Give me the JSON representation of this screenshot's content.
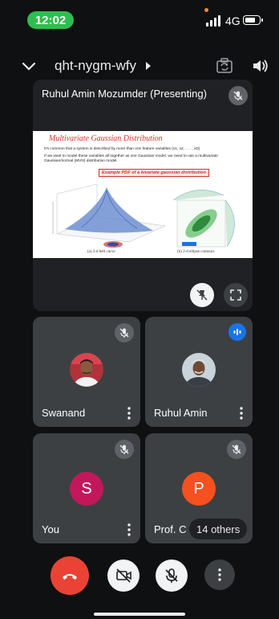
{
  "status_bar": {
    "time": "12:02",
    "network": "4G"
  },
  "header": {
    "meeting_code": "qht-nygm-wfy"
  },
  "main_tile": {
    "presenter_label": "Ruhul Amin Mozumder (Presenting)",
    "slide": {
      "title": "Multivariate Gaussian Distribution",
      "line1": "It's common that a system is described by more than one feature variables (x1, x2, . . . , xD)",
      "line2": "If we want to model these variables all together as one Gaussian model, we need to use a multivariate Gaussian/normal (MVN) distribution model.",
      "highlight": "Example PDF of a bivariate gaussian distribution",
      "caption_a": "(a) 3-d bell curve",
      "caption_b": "(b) 2-d ellipse contours"
    }
  },
  "participants": [
    {
      "name": "Swanand"
    },
    {
      "name": "Ruhul Amin"
    },
    {
      "name": "You",
      "initial": "S",
      "avatar_color": "#c2185b"
    },
    {
      "name": "Prof. C",
      "initial": "P",
      "avatar_color": "#f4511e",
      "others": "14 others"
    }
  ],
  "colors": {
    "hangup": "#ea4335",
    "speaking": "#1a73e8",
    "time_pill": "#2fbd4f"
  }
}
